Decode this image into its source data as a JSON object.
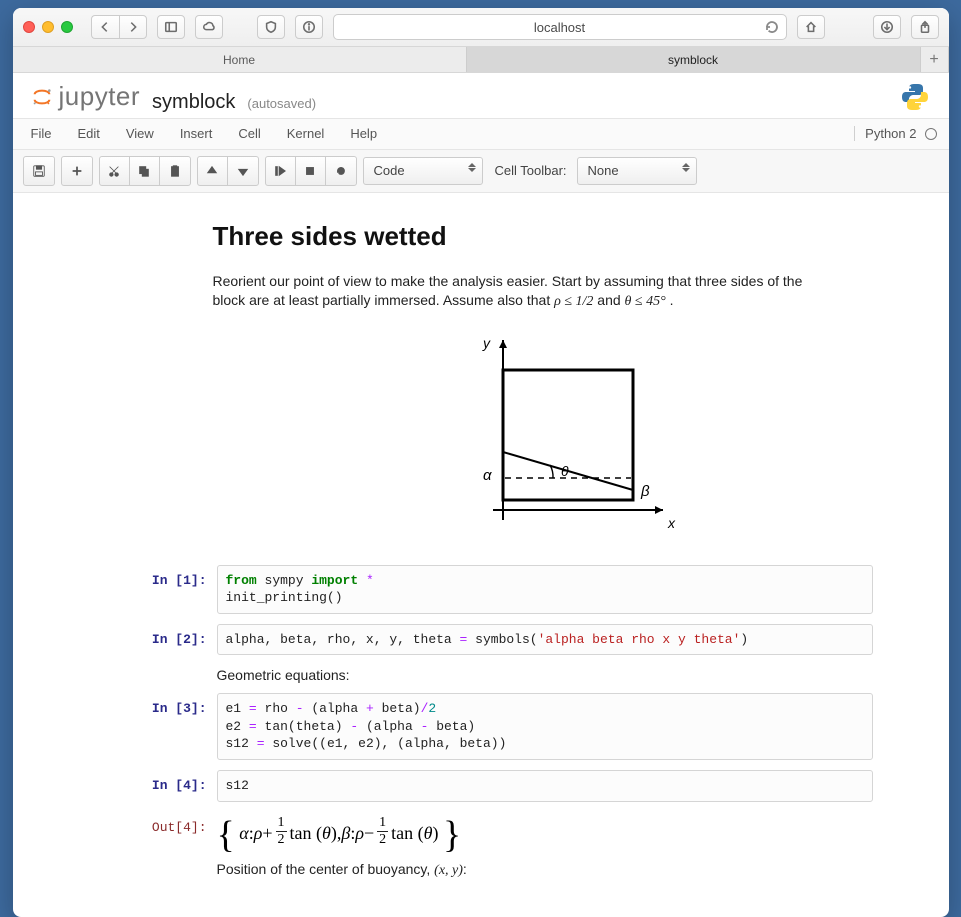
{
  "browser": {
    "address": "localhost",
    "tabs": [
      "Home",
      "symblock"
    ],
    "active_tab": 1
  },
  "jupyter": {
    "notebook_name": "symblock",
    "save_status": "(autosaved)",
    "kernel_label": "Python 2",
    "menus": [
      "File",
      "Edit",
      "View",
      "Insert",
      "Cell",
      "Kernel",
      "Help"
    ],
    "cell_type": "Code",
    "cell_toolbar_label": "Cell Toolbar:",
    "cell_toolbar_value": "None"
  },
  "markdown": {
    "heading": "Three sides wetted",
    "p1a": "Reorient our point of view to make the analysis easier. Start by assuming that three sides of the block are at least partially immersed. Assume also that ",
    "p1b": "ρ ≤ 1/2",
    "p1c": " and ",
    "p1d": "θ ≤ 45°",
    "p1e": ".",
    "geom_label": "Geometric equations:",
    "pos_label_a": "Position of the center of buoyancy, ",
    "pos_label_b": "(x, y)",
    "pos_label_c": ":"
  },
  "diagram": {
    "x_label": "x",
    "y_label": "y",
    "alpha_label": "α",
    "beta_label": "β",
    "theta_label": "θ"
  },
  "cells": {
    "in1_prompt": "In [1]:",
    "in1_line1_kw1": "from",
    "in1_line1_mod": " sympy ",
    "in1_line1_kw2": "import",
    "in1_line1_star": " *",
    "in1_line2": "init_printing()",
    "in2_prompt": "In [2]:",
    "in2_a": "alpha, beta, rho, x, y, theta ",
    "in2_eq": "=",
    "in2_b": " symbols(",
    "in2_str": "'alpha beta rho x y theta'",
    "in2_c": ")",
    "in3_prompt": "In [3]:",
    "in3_l1_a": "e1 ",
    "in3_l1_eq": "=",
    "in3_l1_b": " rho ",
    "in3_l1_minus": "-",
    "in3_l1_c": " (alpha ",
    "in3_l1_plus": "+",
    "in3_l1_d": " beta)",
    "in3_l1_div": "/",
    "in3_l1_two": "2",
    "in3_l2_a": "e2 ",
    "in3_l2_eq": "=",
    "in3_l2_b": " tan(theta) ",
    "in3_l2_minus": "-",
    "in3_l2_c": " (alpha ",
    "in3_l2_sub": "-",
    "in3_l2_d": " beta)",
    "in3_l3_a": "s12 ",
    "in3_l3_eq": "=",
    "in3_l3_b": " solve((e1, e2), (alpha, beta))",
    "in4_prompt": "In [4]:",
    "in4_code": "s12",
    "out4_prompt": "Out[4]:",
    "out4": {
      "alpha_sym": "α",
      "rho_sym": "ρ",
      "theta_sym": "θ",
      "beta_sym": "β",
      "tan": "tan",
      "sep": ",   ",
      "colon": " : ",
      "plus": " + ",
      "minus": " − "
    }
  }
}
